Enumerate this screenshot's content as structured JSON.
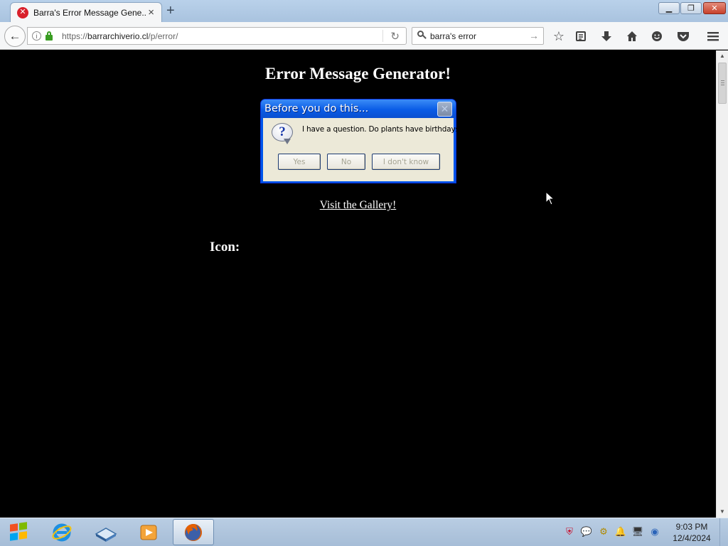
{
  "browser": {
    "tab_title": "Barra's Error Message Gene...",
    "tab_icon_glyph": "✕",
    "new_tab_glyph": "+",
    "url_prefix": "https://",
    "url_host": "barrarchiverio.cl",
    "url_path": "/p/error/",
    "search_value": "barra's error",
    "toolbar_icons": [
      "bookmark-star-icon",
      "reading-list-icon",
      "downloads-icon",
      "home-icon",
      "hello-icon",
      "pocket-icon",
      "menu-icon"
    ]
  },
  "page": {
    "title": "Error Message Generator!",
    "gallery_link": "Visit the Gallery!",
    "icon_label": "Icon:"
  },
  "dialog": {
    "title": "Before you do this...",
    "message": "I have a question. Do plants have birthdays?",
    "buttons": {
      "yes": "Yes",
      "no": "No",
      "dont_know": "I don't know"
    },
    "icon": "question-icon"
  },
  "taskbar": {
    "items": [
      "internet-explorer-icon",
      "book-app-icon",
      "media-player-icon",
      "firefox-icon"
    ],
    "tray_icons": [
      "security-shield-icon",
      "chat-bubble-icon",
      "network-plug-icon",
      "notification-bell-icon",
      "monitor-icon",
      "update-icon"
    ],
    "clock_time": "9:03 PM",
    "clock_date": "12/4/2024"
  },
  "colors": {
    "page_background": "#000000",
    "dialog_titlebar": "#0a5ce6",
    "dialog_body": "#ece9d8",
    "lock_green": "#3a9d23",
    "tab_error_red": "#d9202b"
  }
}
